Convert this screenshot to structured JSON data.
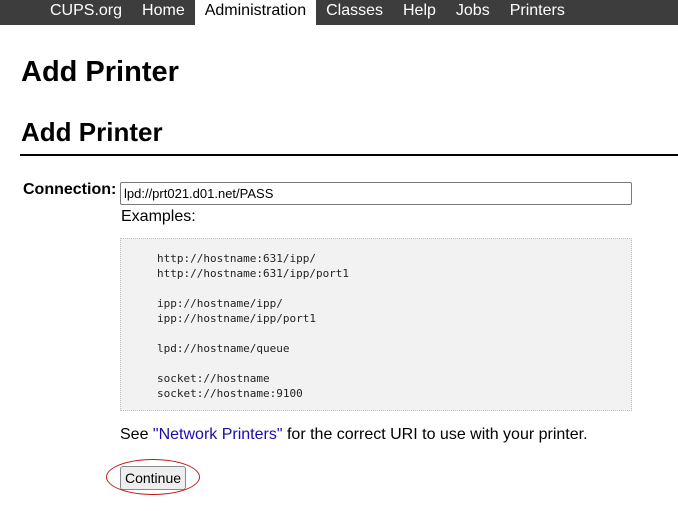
{
  "nav": {
    "items": [
      "CUPS.org",
      "Home",
      "Administration",
      "Classes",
      "Help",
      "Jobs",
      "Printers"
    ],
    "active": "Administration"
  },
  "page": {
    "title": "Add Printer",
    "section_title": "Add Printer"
  },
  "form": {
    "connection_label": "Connection:",
    "connection_value": "lpd://prt021.d01.net/PASS",
    "examples_label": "Examples:",
    "examples": [
      "http://hostname:631/ipp/",
      "http://hostname:631/ipp/port1",
      "",
      "ipp://hostname/ipp/",
      "ipp://hostname/ipp/port1",
      "",
      "lpd://hostname/queue",
      "",
      "socket://hostname",
      "socket://hostname:9100"
    ],
    "hint_before": "See ",
    "hint_link": "\"Network Printers\"",
    "hint_after": " for the correct URI to use with your printer.",
    "continue_label": "Continue"
  },
  "colors": {
    "nav_bg": "#3d3d3d",
    "link": "#1a0dab",
    "highlight": "#c01818"
  }
}
